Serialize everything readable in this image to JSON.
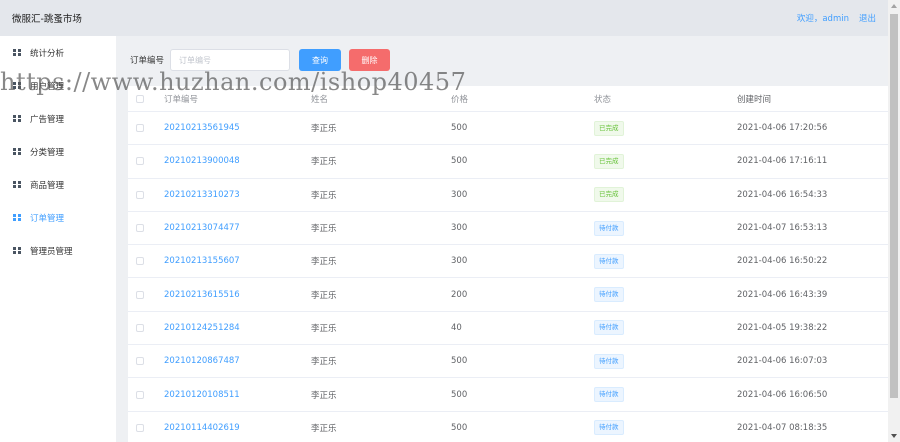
{
  "header": {
    "app_title": "微服汇-跳蚤市场",
    "welcome": "欢迎，admin",
    "logout": "退出"
  },
  "sidebar": {
    "items": [
      {
        "label": "统计分析",
        "active": false
      },
      {
        "label": "用户管理",
        "active": false
      },
      {
        "label": "广告管理",
        "active": false
      },
      {
        "label": "分类管理",
        "active": false
      },
      {
        "label": "商品管理",
        "active": false
      },
      {
        "label": "订单管理",
        "active": true
      },
      {
        "label": "管理员管理",
        "active": false
      }
    ]
  },
  "search": {
    "label": "订单编号",
    "placeholder": "订单编号",
    "value": "",
    "query_button": "查询",
    "delete_button": "删除"
  },
  "table": {
    "headers": {
      "order_no": "订单编号",
      "name": "姓名",
      "price": "价格",
      "status": "状态",
      "created": "创建时间"
    },
    "rows": [
      {
        "order_no": "20210213561945",
        "name": "李正乐",
        "price": "500",
        "status": "已完成",
        "status_type": "done",
        "created": "2021-04-06 17:20:56"
      },
      {
        "order_no": "20210213900048",
        "name": "李正乐",
        "price": "500",
        "status": "已完成",
        "status_type": "done",
        "created": "2021-04-06 17:16:11"
      },
      {
        "order_no": "20210213310273",
        "name": "李正乐",
        "price": "300",
        "status": "已完成",
        "status_type": "done",
        "created": "2021-04-06 16:54:33"
      },
      {
        "order_no": "20210213074477",
        "name": "李正乐",
        "price": "300",
        "status": "待付款",
        "status_type": "wait",
        "created": "2021-04-07 16:53:13"
      },
      {
        "order_no": "20210213155607",
        "name": "李正乐",
        "price": "300",
        "status": "待付款",
        "status_type": "wait",
        "created": "2021-04-06 16:50:22"
      },
      {
        "order_no": "20210213615516",
        "name": "李正乐",
        "price": "200",
        "status": "待付款",
        "status_type": "wait",
        "created": "2021-04-06 16:43:39"
      },
      {
        "order_no": "20210124251284",
        "name": "李正乐",
        "price": "40",
        "status": "待付款",
        "status_type": "wait",
        "created": "2021-04-05 19:38:22"
      },
      {
        "order_no": "20210120867487",
        "name": "李正乐",
        "price": "500",
        "status": "待付款",
        "status_type": "wait",
        "created": "2021-04-06 16:07:03"
      },
      {
        "order_no": "20210120108511",
        "name": "李正乐",
        "price": "500",
        "status": "待付款",
        "status_type": "wait",
        "created": "2021-04-06 16:06:50"
      },
      {
        "order_no": "20210114402619",
        "name": "李正乐",
        "price": "500",
        "status": "待付款",
        "status_type": "wait",
        "created": "2021-04-07 08:18:35"
      }
    ]
  },
  "watermark": "https://www.huzhan.com/ishop40457",
  "colors": {
    "accent": "#409eff",
    "danger": "#f56c6c",
    "success": "#67c23a"
  }
}
